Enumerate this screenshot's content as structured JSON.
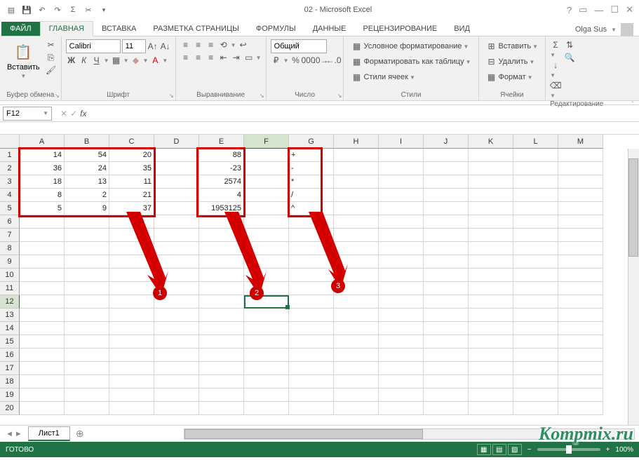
{
  "title": "02 - Microsoft Excel",
  "user": "Olga Sus",
  "tabs": {
    "file": "ФАЙЛ",
    "items": [
      "ГЛАВНАЯ",
      "ВСТАВКА",
      "РАЗМЕТКА СТРАНИЦЫ",
      "ФОРМУЛЫ",
      "ДАННЫЕ",
      "РЕЦЕНЗИРОВАНИЕ",
      "ВИД"
    ],
    "active": 0
  },
  "ribbon": {
    "clipboard": {
      "label": "Буфер обмена",
      "paste": "Вставить"
    },
    "font": {
      "label": "Шрифт",
      "name": "Calibri",
      "size": "11"
    },
    "align": {
      "label": "Выравнивание"
    },
    "number": {
      "label": "Число",
      "format": "Общий"
    },
    "styles": {
      "label": "Стили",
      "cond": "Условное форматирование",
      "table": "Форматировать как таблицу",
      "cell": "Стили ячеек"
    },
    "cells": {
      "label": "Ячейки",
      "insert": "Вставить",
      "delete": "Удалить",
      "format": "Формат"
    },
    "editing": {
      "label": "Редактирование"
    }
  },
  "name_box": "F12",
  "columns": [
    "A",
    "B",
    "C",
    "D",
    "E",
    "F",
    "G",
    "H",
    "I",
    "J",
    "K",
    "L",
    "M"
  ],
  "rows": 20,
  "cell_data": {
    "1": {
      "A": "14",
      "B": "54",
      "C": "20",
      "E": "88",
      "G": "+"
    },
    "2": {
      "A": "36",
      "B": "24",
      "C": "35",
      "E": "-23",
      "G": "-"
    },
    "3": {
      "A": "18",
      "B": "13",
      "C": "11",
      "E": "2574",
      "G": "*"
    },
    "4": {
      "A": "8",
      "B": "2",
      "C": "21",
      "E": "4",
      "G": "/"
    },
    "5": {
      "A": "5",
      "B": "9",
      "C": "37",
      "E": "1953125",
      "G": "^"
    }
  },
  "selected_cell": {
    "row": 12,
    "col": "F"
  },
  "sheet": "Лист1",
  "status": "ГОТОВО",
  "zoom": "100%",
  "annotations": {
    "1": "1",
    "2": "2",
    "3": "3"
  },
  "watermark": "Kompmix.ru"
}
